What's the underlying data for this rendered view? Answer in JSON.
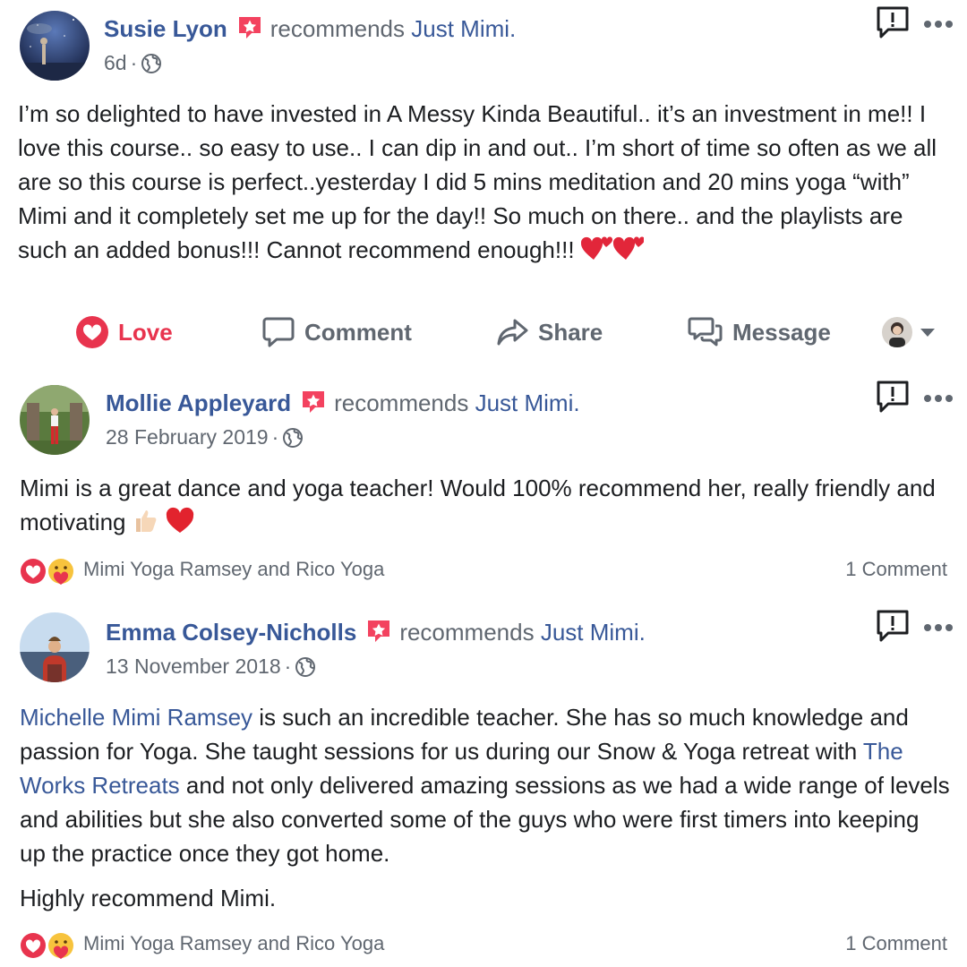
{
  "common": {
    "recommends_text": "recommends",
    "page_name": "Just Mimi.",
    "dot": "·"
  },
  "posts": [
    {
      "author": "Susie Lyon",
      "timestamp": "6d",
      "body": [
        "I’m so delighted to have invested in A Messy Kinda Beautiful.. it’s an investment in me!! I love this course.. so easy to use.. I can dip in and out.. I’m short of time so often as we all are so this course is perfect..yesterday I did 5 mins meditation and 20 mins yoga “with” Mimi and it completely set me up for the day!! So much on there.. and the playlists are such an added bonus!!! Cannot recommend enough!!!"
      ],
      "actions": {
        "love": "Love",
        "comment": "Comment",
        "share": "Share",
        "message": "Message"
      }
    },
    {
      "author": "Mollie Appleyard",
      "timestamp": "28 February 2019",
      "body": [
        "Mimi is a great dance and yoga teacher! Would 100% recommend her, really friendly and motivating"
      ],
      "reactors": "Mimi Yoga Ramsey and Rico Yoga",
      "comment_count": "1 Comment"
    },
    {
      "author": "Emma Colsey-Nicholls",
      "timestamp": "13 November 2018",
      "body_link1": "Michelle Mimi Ramsey",
      "body_part1": " is such an incredible teacher. She has so much knowledge and passion for Yoga. She taught sessions for us during our Snow & Yoga retreat with ",
      "body_link2": "The Works Retreats",
      "body_part2": " and not only delivered amazing sessions as we had a wide range of levels and abilities but she also converted some of the guys who were first timers into keeping up the practice once they got home.",
      "body_para2": "Highly recommend Mimi.",
      "reactors": "Mimi Yoga Ramsey and Rico Yoga",
      "comment_count": "1 Comment"
    }
  ],
  "colors": {
    "link": "#385898",
    "secondary_text": "#606770",
    "love_red": "#e8344e",
    "recommend_badge": "#f3425f"
  },
  "icons": [
    "recommend-star-icon",
    "globe-icon",
    "report-icon",
    "more-icon",
    "love-icon",
    "comment-icon",
    "share-icon",
    "message-icon",
    "caret-down-icon",
    "love-reaction-icon",
    "care-reaction-icon",
    "two-hearts-emoji",
    "thumbs-up-emoji",
    "red-heart-emoji"
  ]
}
